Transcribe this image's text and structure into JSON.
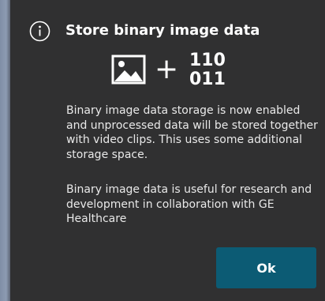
{
  "dialog": {
    "title": "Store binary image data",
    "info_icon": "info-circle-icon",
    "graphic": {
      "image_icon": "image-icon",
      "plus": "+",
      "binary_line_1": "110",
      "binary_line_2": "011"
    },
    "paragraph_1": "Binary image data storage is now enabled and unprocessed data will be stored together with video clips. This uses some additional storage space.",
    "paragraph_2": "Binary image data is useful for research and development in collaboration with GE Healthcare",
    "ok_label": "Ok"
  },
  "colors": {
    "dialog_background": "#303031",
    "button_background": "#0c5b74",
    "text": "#ffffff",
    "left_strip": "#8d9bb2"
  }
}
